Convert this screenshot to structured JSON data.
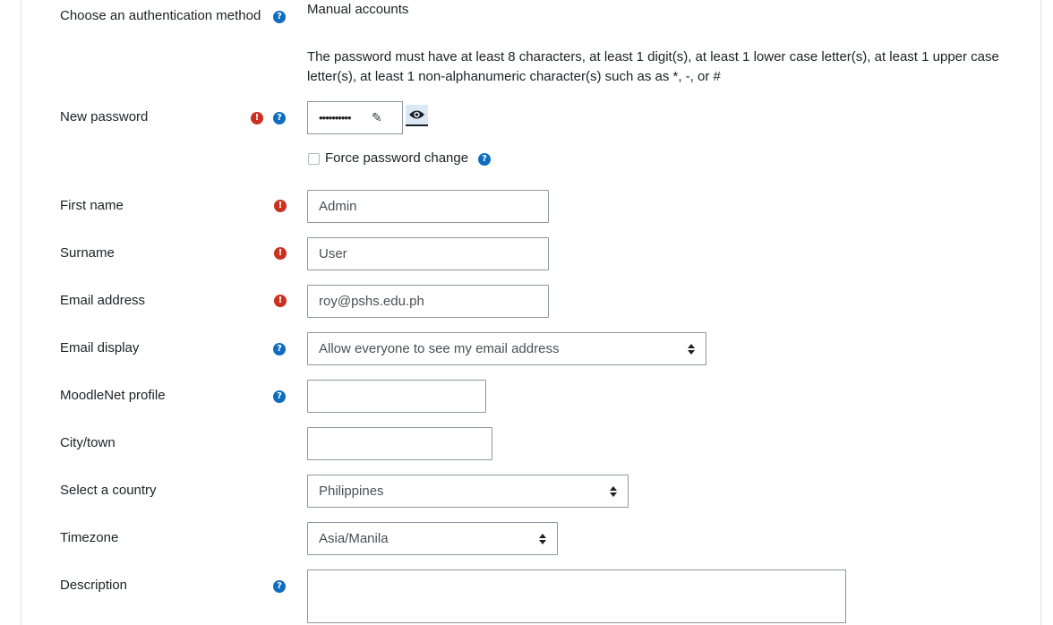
{
  "form": {
    "auth": {
      "label": "Choose an authentication method",
      "value": "Manual accounts"
    },
    "password_rules": "The password must have at least 8 characters, at least 1 digit(s), at least 1 lower case letter(s), at least 1 upper case letter(s), at least 1 non-alphanumeric character(s) such as as *, -, or #",
    "new_password": {
      "label": "New password",
      "masked_value": "••••••••••"
    },
    "force_change": {
      "label": "Force password change",
      "checked": false
    },
    "first_name": {
      "label": "First name",
      "value": "Admin"
    },
    "surname": {
      "label": "Surname",
      "value": "User"
    },
    "email": {
      "label": "Email address",
      "value": "roy@pshs.edu.ph"
    },
    "email_display": {
      "label": "Email display",
      "value": "Allow everyone to see my email address"
    },
    "moodlenet": {
      "label": "MoodleNet profile",
      "value": ""
    },
    "city": {
      "label": "City/town",
      "value": ""
    },
    "country": {
      "label": "Select a country",
      "value": "Philippines"
    },
    "timezone": {
      "label": "Timezone",
      "value": "Asia/Manila"
    },
    "description": {
      "label": "Description",
      "value": ""
    }
  },
  "icons": {
    "help": "question-circle-icon",
    "required": "exclamation-circle-icon",
    "reveal": "eye-icon",
    "edit": "pencil-icon"
  },
  "colors": {
    "help": "#0f6cbf",
    "required": "#ca3120",
    "border": "#8f959e",
    "text": "#1d2125"
  }
}
